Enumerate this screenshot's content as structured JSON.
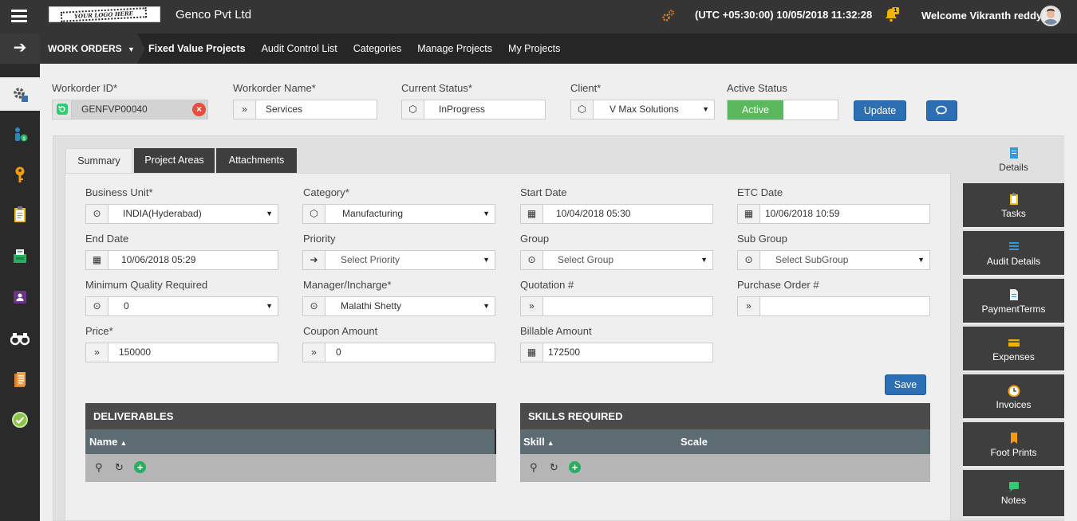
{
  "header": {
    "logo_text": "YOUR LOGO HERE",
    "company": "Genco Pvt Ltd",
    "datetime": "(UTC +05:30:00) 10/05/2018 11:32:28",
    "notification_count": "1",
    "welcome": "Welcome Vikranth reddy"
  },
  "nav": {
    "work_orders": "WORK ORDERS",
    "links": [
      "Fixed Value Projects",
      "Audit Control List",
      "Categories",
      "Manage Projects",
      "My Projects"
    ]
  },
  "form": {
    "workorder_id": {
      "label": "Workorder ID*",
      "value": "GENFVP00040"
    },
    "workorder_name": {
      "label": "Workorder Name*",
      "value": "Services"
    },
    "current_status": {
      "label": "Current Status*",
      "value": "InProgress"
    },
    "client": {
      "label": "Client*",
      "value": "V Max Solutions"
    },
    "active_status": {
      "label": "Active Status",
      "value": "Active"
    },
    "update_label": "Update"
  },
  "tabs": [
    "Summary",
    "Project Areas",
    "Attachments"
  ],
  "summary": {
    "business_unit": {
      "label": "Business Unit*",
      "value": "INDIA(Hyderabad)"
    },
    "category": {
      "label": "Category*",
      "value": "Manufacturing"
    },
    "start_date": {
      "label": "Start Date",
      "value": "10/04/2018 05:30"
    },
    "etc_date": {
      "label": "ETC Date",
      "value": "10/06/2018 10:59"
    },
    "end_date": {
      "label": "End Date",
      "value": "10/06/2018 05:29"
    },
    "priority": {
      "label": "Priority",
      "value": "Select Priority"
    },
    "group": {
      "label": "Group",
      "value": "Select Group"
    },
    "sub_group": {
      "label": "Sub Group",
      "value": "Select SubGroup"
    },
    "min_quality": {
      "label": "Minimum Quality Required",
      "value": "0"
    },
    "manager": {
      "label": "Manager/Incharge*",
      "value": "Malathi Shetty"
    },
    "quotation": {
      "label": "Quotation #",
      "value": ""
    },
    "purchase_order": {
      "label": "Purchase Order #",
      "value": ""
    },
    "price": {
      "label": "Price*",
      "value": "150000"
    },
    "coupon": {
      "label": "Coupon Amount",
      "value": "0"
    },
    "billable": {
      "label": "Billable Amount",
      "value": "172500"
    },
    "save_label": "Save"
  },
  "deliverables": {
    "title": "DELIVERABLES",
    "col_name": "Name"
  },
  "skills": {
    "title": "SKILLS REQUIRED",
    "col_skill": "Skill",
    "col_scale": "Scale"
  },
  "right_tabs": [
    "Details",
    "Tasks",
    "Audit Details",
    "PaymentTerms",
    "Expenses",
    "Invoices",
    "Foot Prints",
    "Notes"
  ],
  "colors": {
    "accent_blue": "#2d6fb5",
    "active_green": "#5cb85c",
    "header_dark": "#353535"
  }
}
